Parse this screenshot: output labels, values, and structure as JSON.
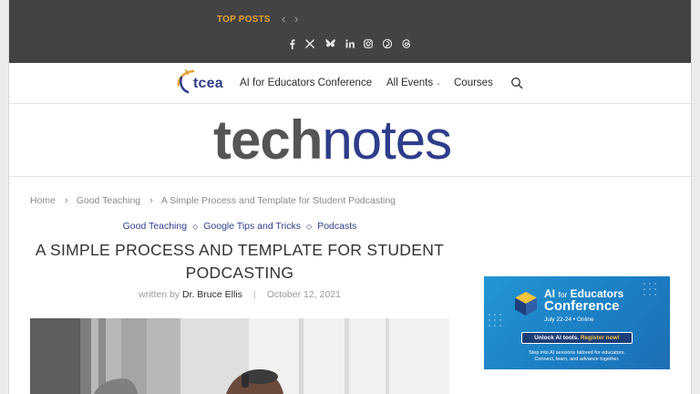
{
  "topbar": {
    "top_posts_label": "TOP POSTS",
    "prev_icon": "chevron-left-icon",
    "next_icon": "chevron-right-icon",
    "social_icons": [
      "facebook-icon",
      "x-icon",
      "bluesky-icon",
      "linkedin-icon",
      "instagram-icon",
      "pinterest-icon",
      "threads-icon"
    ]
  },
  "nav": {
    "logo_text": "tcea",
    "items": [
      "AI for Educators Conference",
      "All Events",
      "Courses"
    ],
    "dropdown_icon": "chevron-down-icon",
    "search_icon": "search-icon"
  },
  "masthead": {
    "brand_part1": "tech",
    "brand_part2": "notes"
  },
  "breadcrumb": {
    "items": [
      "Home",
      "Good Teaching",
      "A Simple Process and Template for Student Podcasting"
    ],
    "separator": "›"
  },
  "post": {
    "categories": [
      "Good Teaching",
      "Google Tips and Tricks",
      "Podcasts"
    ],
    "category_separator": "◇",
    "title": "A Simple Process and Template for Student Podcasting",
    "written_by_label": "written by",
    "author": "Dr. Bruce Ellis",
    "date": "October 12, 2021"
  },
  "ad": {
    "title_prefix": "AI",
    "title_for": "for",
    "title_rest": "Educators",
    "title_line2": "Conference",
    "date": "July 22-24 • Online",
    "cta_text": "Unlock AI tools.",
    "cta_highlight": "Register now!",
    "line1": "Step into AI sessions tailored for educators.",
    "line2": "Connect, learn, and advance together."
  },
  "colors": {
    "topbar_bg": "#434345",
    "accent_orange": "#e3a233",
    "brand_navy": "#2e3d8a",
    "brand_gray": "#555558",
    "ad_blue": "#1f88cc"
  }
}
